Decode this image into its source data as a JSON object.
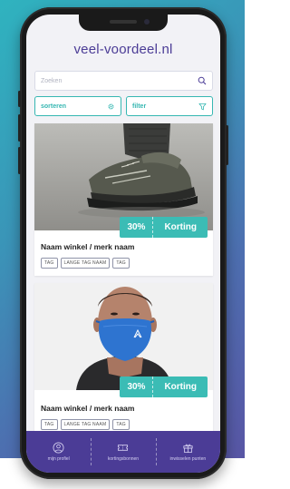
{
  "app": {
    "logo": "veel-voordeel.nl"
  },
  "search": {
    "placeholder": "Zoeken"
  },
  "filters": {
    "sort_label": "sorteren",
    "filter_label": "filter"
  },
  "cards": [
    {
      "title": "Naam winkel / merk naam",
      "discount": "30%",
      "discount_label": "Korting",
      "tags": [
        "TAG",
        "LANGE TAG NAAM",
        "TAG"
      ],
      "image": "sneaker"
    },
    {
      "title": "Naam winkel / merk naam",
      "discount": "30%",
      "discount_label": "Korting",
      "tags": [
        "TAG",
        "LANGE TAG NAAM",
        "TAG"
      ],
      "image": "face-mask"
    }
  ],
  "nav": [
    {
      "label": "mijn profiel",
      "icon": "user-icon"
    },
    {
      "label": "kortingsbonnen",
      "icon": "coupon-icon"
    },
    {
      "label": "inwisselen punten",
      "icon": "gift-icon"
    }
  ],
  "colors": {
    "primary": "#4b3c96",
    "accent": "#3bbcb5",
    "background": "#f2f2f6"
  }
}
